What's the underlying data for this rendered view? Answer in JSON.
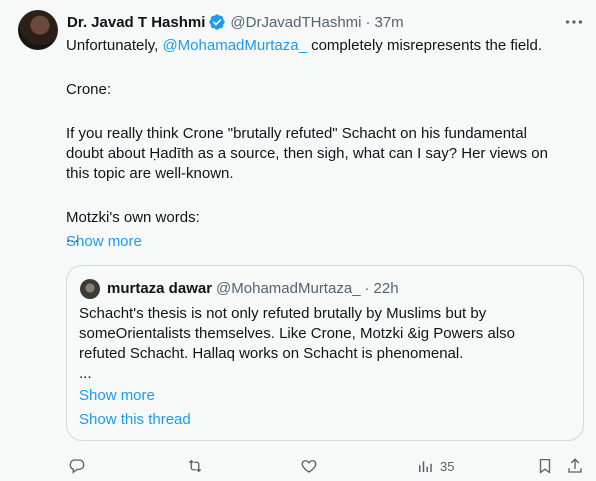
{
  "tweet": {
    "author_name": "Dr. Javad T Hashmi",
    "author_handle": "@DrJavadTHashmi",
    "separator": "·",
    "time": "37m",
    "line1_prefix": "Unfortunately, ",
    "line1_mention": "@MohamadMurtaza_",
    "line1_suffix": " completely misrepresents the field.",
    "line2": "Crone:",
    "line3": "If you really think Crone \"brutally refuted\" Schacht on his fundamental",
    "line4": "doubt about Ḥadīth as a source, then sigh, what can I say? Her views on",
    "line5": "this topic are well-known.",
    "line6": "Motzki's own words:",
    "line7": "...",
    "show_more": "Show more"
  },
  "quote": {
    "author_name": "murtaza dawar",
    "author_handle": "@MohamadMurtaza_",
    "separator": "·",
    "time": "22h",
    "line1": "Schacht's thesis is not only refuted brutally by Muslims but by",
    "line2": "someOrientalists themselves. Like Crone, Motzki &ig Powers also",
    "line3": "refuted Schacht. Hallaq works on Schacht is phenomenal.",
    "line4": "...",
    "show_more": "Show more",
    "show_thread": "Show this thread"
  },
  "actions": {
    "reply_icon": "reply-icon",
    "retweet_icon": "retweet-icon",
    "like_icon": "heart-icon",
    "views_icon": "views-icon",
    "views_count": "35",
    "bookmark_icon": "bookmark-icon",
    "share_icon": "share-icon"
  },
  "colors": {
    "accent": "#1d9bf0",
    "secondary_text": "#536471",
    "border": "#cfd9de",
    "background": "#f7f9f9"
  }
}
